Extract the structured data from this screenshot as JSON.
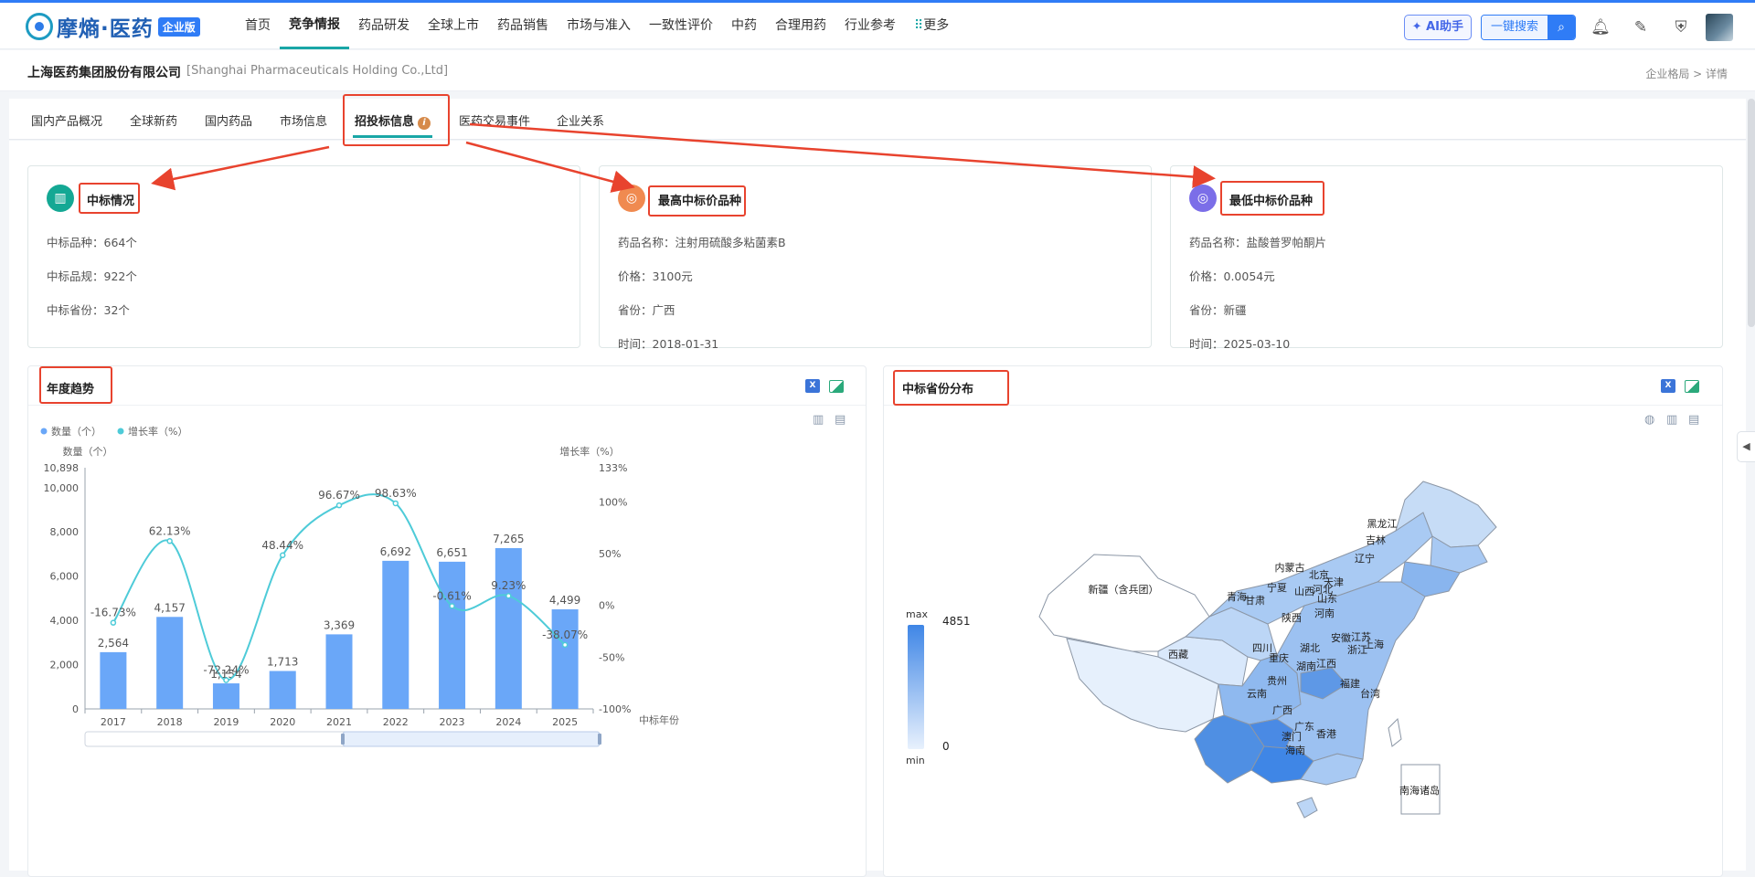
{
  "app": {
    "logo_text": "摩熵·医药",
    "edition_badge": "企业版"
  },
  "nav": {
    "items": [
      "首页",
      "竞争情报",
      "药品研发",
      "全球上市",
      "药品销售",
      "市场与准入",
      "一致性评价",
      "中药",
      "合理用药",
      "行业参考",
      "更多"
    ],
    "active": "竞争情报"
  },
  "header_actions": {
    "ai_label": "AI助手",
    "search_label": "一键搜索"
  },
  "company": {
    "name": "上海医药集团股份有限公司",
    "name_en": "[Shanghai Pharmaceuticals Holding Co.,Ltd]",
    "breadcrumb": "企业格局 > 详情"
  },
  "tabs": {
    "items": [
      "国内产品概况",
      "全球新药",
      "国内药品",
      "市场信息",
      "招投标信息",
      "医药交易事件",
      "企业关系"
    ],
    "active": "招投标信息"
  },
  "cards": {
    "bid_summary": {
      "title": "中标情况",
      "line1": "中标品种：664个",
      "line2": "中标品规：922个",
      "line3": "中标省份：32个"
    },
    "highest": {
      "title": "最高中标价品种",
      "line1": "药品名称：注射用硫酸多粘菌素B",
      "line2": "价格：3100元",
      "line3": "省份：广西",
      "line4": "时间：2018-01-31"
    },
    "lowest": {
      "title": "最低中标价品种",
      "line1": "药品名称：盐酸普罗帕酮片",
      "line2": "价格：0.0054元",
      "line3": "省份：新疆",
      "line4": "时间：2025-03-10"
    }
  },
  "annual_panel": {
    "title": "年度趋势"
  },
  "province_panel": {
    "title": "中标省份分布"
  },
  "chart_data": [
    {
      "type": "bar",
      "categories": [
        "2017",
        "2018",
        "2019",
        "2020",
        "2021",
        "2022",
        "2023",
        "2024",
        "2025"
      ],
      "series": [
        {
          "name": "数量（个）",
          "type": "bar",
          "values": [
            2564,
            4157,
            1154,
            1713,
            3369,
            6692,
            6651,
            7265,
            4499
          ]
        },
        {
          "name": "增长率（%）",
          "type": "line",
          "values": [
            -16.73,
            62.13,
            -72.24,
            48.44,
            96.67,
            98.63,
            -0.61,
            9.23,
            -38.07
          ]
        }
      ],
      "ylabel": "数量（个）",
      "y2label": "增长率（%）",
      "xlabel": "中标年份",
      "ylim": [
        0,
        10898
      ],
      "y2lim": [
        -100,
        133
      ],
      "yticks": [
        "10,898",
        "10,000",
        "8,000",
        "6,000",
        "4,000",
        "2,000",
        "0"
      ],
      "y2ticks": [
        "133%",
        "100%",
        "50%",
        "0%",
        "-50%",
        "-100%"
      ],
      "bar_labels": [
        "2,564",
        "4,157",
        "1,154",
        "1,713",
        "3,369",
        "6,692",
        "6,651",
        "7,265",
        "4,499"
      ],
      "line_labels": [
        "-16.73%",
        "62.13%",
        "-72.24%",
        "48.44%",
        "96.67%",
        "98.63%",
        "-0.61%",
        "9.23%",
        "-38.07%"
      ],
      "legend": "top-left",
      "grid": false,
      "colors": {
        "bar": "#6aa7f8",
        "line": "#4ecbd8"
      }
    },
    {
      "type": "heatmap",
      "map": "china-provinces",
      "visual_map": {
        "max_label": "max",
        "min_label": "min",
        "max_value": "4851",
        "min_value": "0"
      },
      "labels": [
        "新疆（含兵团）",
        "黑龙江",
        "吉林",
        "辽宁",
        "内蒙古",
        "北京",
        "天津",
        "河北",
        "山西",
        "山东",
        "宁夏",
        "甘肃",
        "青海",
        "陕西",
        "河南",
        "江苏",
        "安徽",
        "上海",
        "浙江",
        "湖北",
        "四川",
        "重庆",
        "西藏",
        "湖南",
        "江西",
        "福建",
        "贵州",
        "云南",
        "广西",
        "广东",
        "澳门",
        "香港",
        "海南",
        "台湾",
        "南海诸岛"
      ]
    }
  ]
}
